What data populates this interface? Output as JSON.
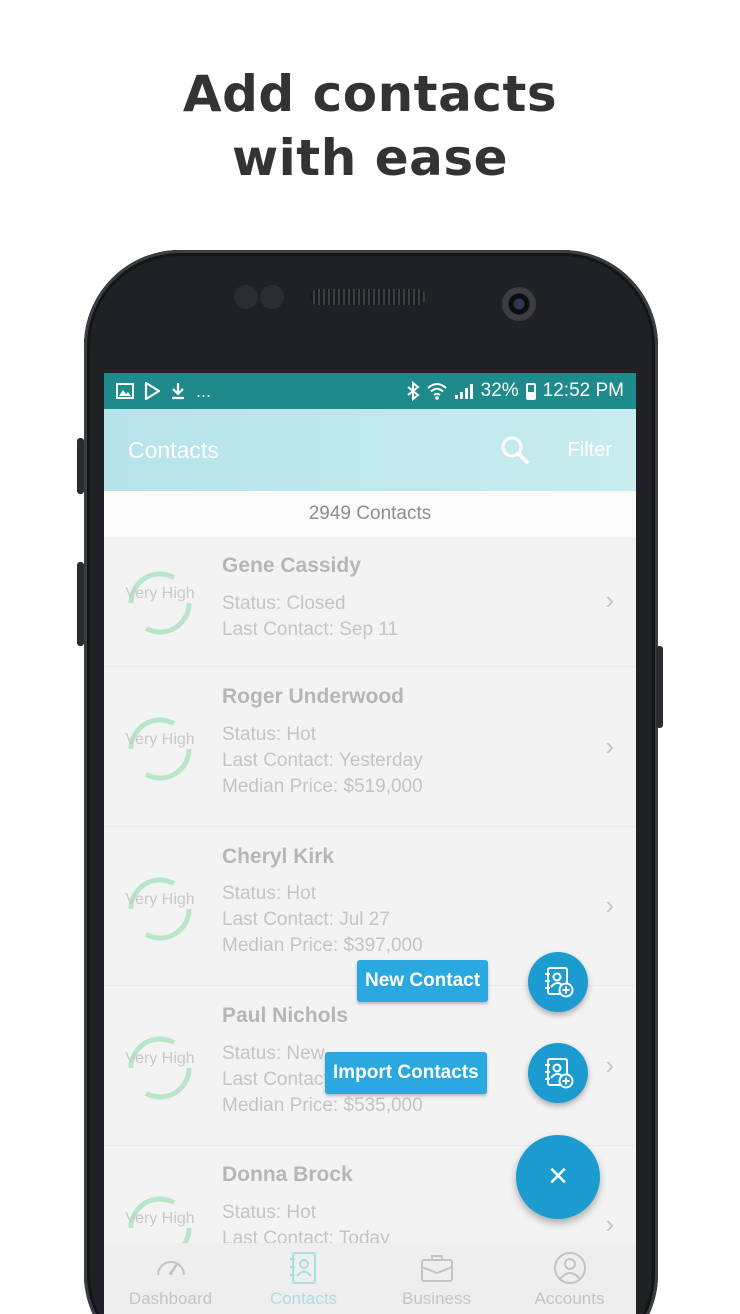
{
  "headline": {
    "line1": "Add contacts",
    "line2": "with ease"
  },
  "status_bar": {
    "left_more": "...",
    "battery": "32%",
    "time": "12:52 PM"
  },
  "app_bar": {
    "title": "Contacts",
    "filter_label": "Filter"
  },
  "contact_count": "2949 Contacts",
  "contacts": [
    {
      "score": "Very High",
      "name": "Gene Cassidy",
      "lines": [
        "Status: Closed",
        "Last Contact: Sep 11"
      ]
    },
    {
      "score": "Very High",
      "name": "Roger Underwood",
      "lines": [
        "Status: Hot",
        "Last Contact: Yesterday",
        "Median Price: $519,000"
      ]
    },
    {
      "score": "Very High",
      "name": "Cheryl Kirk",
      "lines": [
        "Status: Hot",
        "Last Contact: Jul 27",
        "Median Price: $397,000"
      ]
    },
    {
      "score": "Very High",
      "name": "Paul Nichols",
      "lines": [
        "Status: New",
        "Last Contact",
        "Median Price: $535,000"
      ]
    },
    {
      "score": "Very High",
      "name": "Donna Brock",
      "lines": [
        "Status: Hot",
        "Last Contact: Today"
      ]
    }
  ],
  "fab_menu": {
    "new_contact": "New Contact",
    "import_contacts": "Import Contacts",
    "close_glyph": "×"
  },
  "bottom_nav": [
    {
      "label": "Dashboard",
      "icon": "speedometer-icon"
    },
    {
      "label": "Contacts",
      "icon": "contacts-book-icon",
      "active": true
    },
    {
      "label": "Business",
      "icon": "briefcase-icon"
    },
    {
      "label": "Accounts",
      "icon": "user-circle-icon"
    }
  ],
  "colors": {
    "status_bar": "#1e8a8c",
    "app_bar": "#b6e3ea",
    "accent": "#1b9bd0",
    "score_ring": "#b9e6c9"
  }
}
